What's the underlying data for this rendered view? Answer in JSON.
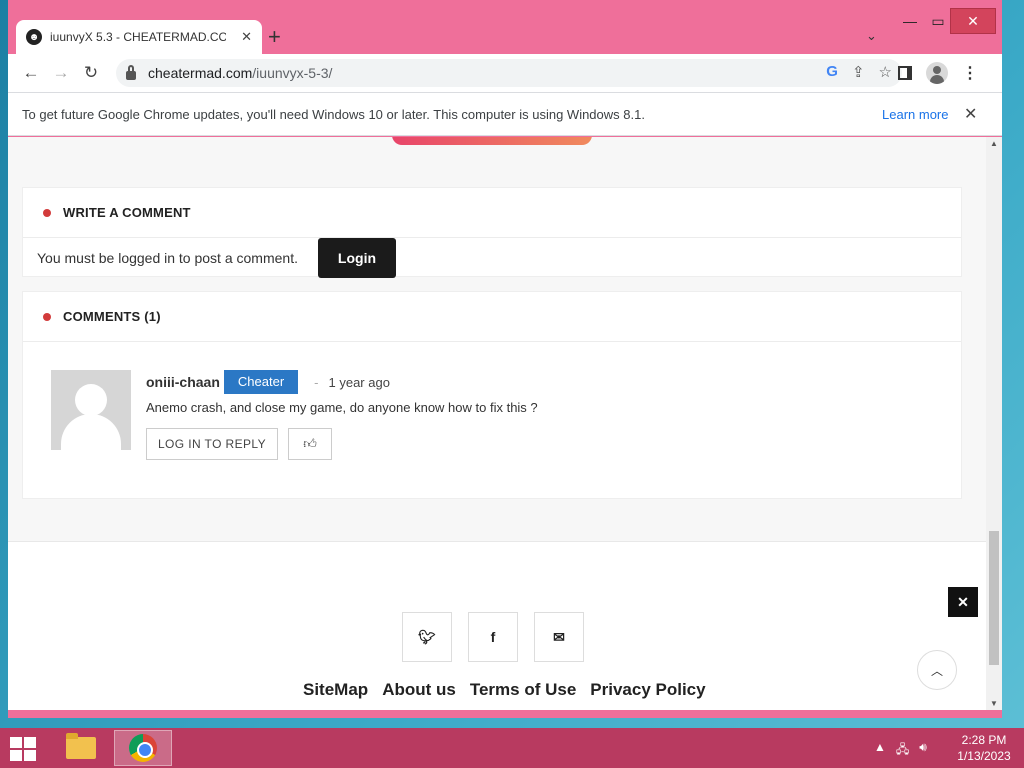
{
  "browser": {
    "tab_title": "iuunvyX 5.3 - CHEATERMAD.COM",
    "tab_close": "✕",
    "new_tab": "+",
    "url_host": "cheatermad.com",
    "url_path": "/iuunvyx-5-3/"
  },
  "infobar": {
    "message": "To get future Google Chrome updates, you'll need Windows 10 or later. This computer is using Windows 8.1.",
    "learn_more": "Learn more"
  },
  "write_comment": {
    "title": "WRITE A COMMENT",
    "message": "You must be logged in to post a comment.",
    "login_label": "Login"
  },
  "comments": {
    "title": "COMMENTS (1)",
    "items": [
      {
        "author": "oniii-chaan",
        "badge": "Cheater",
        "separator": "-",
        "time": "1 year ago",
        "text": "Anemo crash, and close my game, do anyone know how to fix this ?",
        "reply_label": "LOG IN TO REPLY"
      }
    ]
  },
  "footer": {
    "links": [
      "SiteMap",
      "About us",
      "Terms of Use",
      "Privacy Policy"
    ]
  },
  "taskbar": {
    "time": "2:28 PM",
    "date": "1/13/2023"
  },
  "icons": {
    "twitter": "twitter-icon",
    "facebook": "facebook-icon",
    "mail": "mail-icon",
    "like": "thumbs-up-icon"
  },
  "colors": {
    "window_frame": "#ef6f9a",
    "badge": "#2b78c5",
    "dot": "#d23b3b",
    "login_button": "#1b1b1b"
  }
}
